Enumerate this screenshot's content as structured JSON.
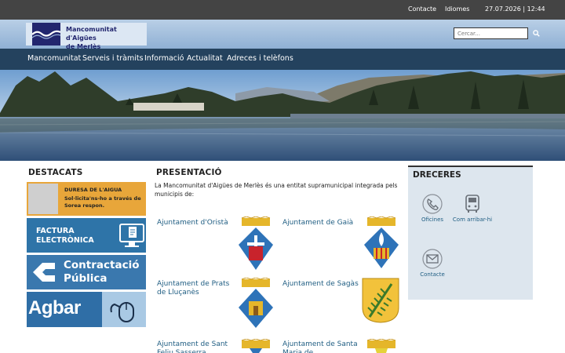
{
  "topbar": {
    "contact_label": "Contacte",
    "languages_label": "Idiomes",
    "datetime": "27.07.2026 | 12:44"
  },
  "header": {
    "logo_line1": "Mancomunitat d'Aigües",
    "logo_line2": "de Merlès",
    "search_placeholder": "Cercar..."
  },
  "nav": {
    "items": [
      "Mancomunitat",
      "Serveis i tràmits",
      "Informació",
      "Actualitat",
      "Adreces i telèfons"
    ]
  },
  "destacats": {
    "title": "DESTACATS",
    "banners": [
      {
        "line1": "DURESA DE L'AIGUA",
        "line2": "Sol·licita'ns-ho a través de Sorea respon."
      },
      {
        "line1": "FACTURA",
        "line2": "ELECTRÒNICA"
      },
      {
        "line1": "Contractació",
        "line2": "Pública"
      },
      {
        "line1": "Agbar"
      }
    ]
  },
  "presentacio": {
    "title": "PRESENTACIÓ",
    "intro": "La Mancomunitat d'Aigües de Merlès és una entitat supramunicipal integrada pels municipis de:",
    "towns": [
      {
        "name": "Ajuntament d'Oristà",
        "crest": "orista-crest-icon"
      },
      {
        "name": "Ajuntament de Gaià",
        "crest": "gaia-crest-icon"
      },
      {
        "name": "Ajuntament de Prats de Lluçanès",
        "crest": "prats-crest-icon"
      },
      {
        "name": "Ajuntament de Sagàs",
        "crest": "sagas-crest-icon"
      },
      {
        "name": "Ajuntament de Sant Feliu Sasserra",
        "crest": "sant-feliu-crest-icon"
      },
      {
        "name": "Ajuntament de Santa Maria de",
        "crest": "santa-maria-crest-icon"
      }
    ]
  },
  "dreceres": {
    "title": "DRECERES",
    "items": [
      {
        "label": "Oficines",
        "icon": "phone-icon"
      },
      {
        "label": "Com arribar-hi",
        "icon": "bus-icon"
      },
      {
        "label": "Contacte",
        "icon": "mail-icon"
      }
    ]
  }
}
